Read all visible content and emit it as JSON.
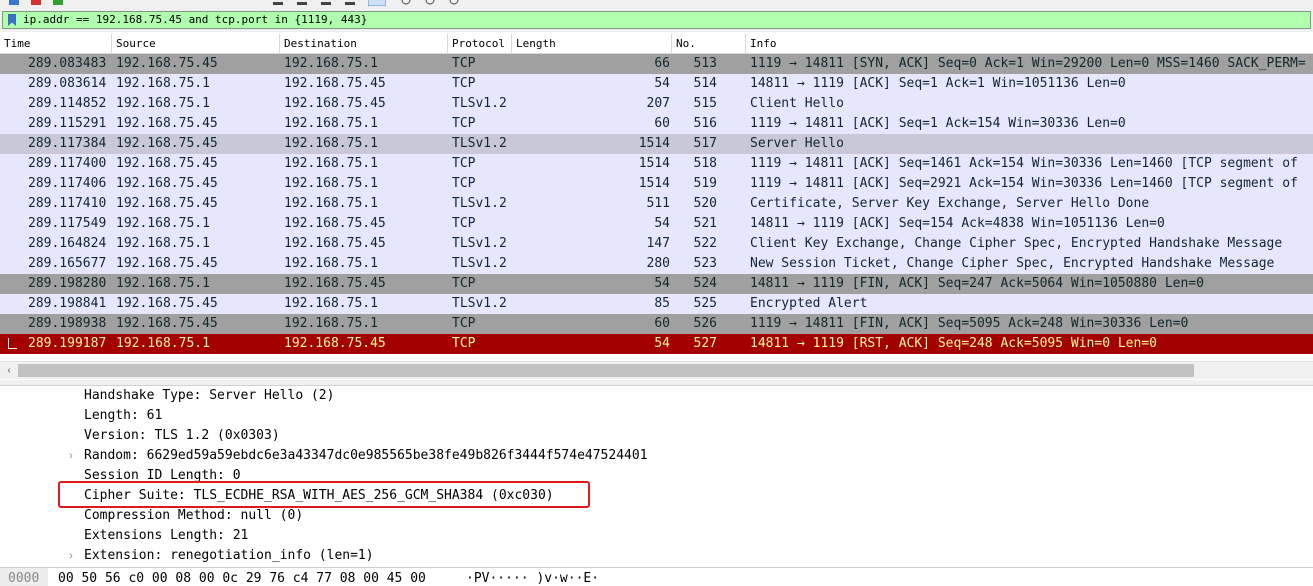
{
  "filter": {
    "value": "ip.addr == 192.168.75.45 and tcp.port in {1119, 443}"
  },
  "columns": {
    "time": "Time",
    "source": "Source",
    "destination": "Destination",
    "protocol": "Protocol",
    "length": "Length",
    "no": "No.",
    "info": "Info"
  },
  "packets": [
    {
      "time": "289.083483",
      "source": "192.168.75.45",
      "destination": "192.168.75.1",
      "protocol": "TCP",
      "length": "66",
      "no": "513",
      "info": "1119 → 14811 [SYN, ACK] Seq=0 Ack=1 Win=29200 Len=0 MSS=1460 SACK_PERM=",
      "style": "dark"
    },
    {
      "time": "289.083614",
      "source": "192.168.75.1",
      "destination": "192.168.75.45",
      "protocol": "TCP",
      "length": "54",
      "no": "514",
      "info": "14811 → 1119 [ACK] Seq=1 Ack=1 Win=1051136 Len=0",
      "style": "tcp"
    },
    {
      "time": "289.114852",
      "source": "192.168.75.1",
      "destination": "192.168.75.45",
      "protocol": "TLSv1.2",
      "length": "207",
      "no": "515",
      "info": "Client Hello",
      "style": "tls"
    },
    {
      "time": "289.115291",
      "source": "192.168.75.45",
      "destination": "192.168.75.1",
      "protocol": "TCP",
      "length": "60",
      "no": "516",
      "info": "1119 → 14811 [ACK] Seq=1 Ack=154 Win=30336 Len=0",
      "style": "tcp"
    },
    {
      "time": "289.117384",
      "source": "192.168.75.45",
      "destination": "192.168.75.1",
      "protocol": "TLSv1.2",
      "length": "1514",
      "no": "517",
      "info": "Server Hello",
      "style": "light2"
    },
    {
      "time": "289.117400",
      "source": "192.168.75.45",
      "destination": "192.168.75.1",
      "protocol": "TCP",
      "length": "1514",
      "no": "518",
      "info": "1119 → 14811 [ACK] Seq=1461 Ack=154 Win=30336 Len=1460 [TCP segment of",
      "style": "tcp"
    },
    {
      "time": "289.117406",
      "source": "192.168.75.45",
      "destination": "192.168.75.1",
      "protocol": "TCP",
      "length": "1514",
      "no": "519",
      "info": "1119 → 14811 [ACK] Seq=2921 Ack=154 Win=30336 Len=1460 [TCP segment of",
      "style": "tcp"
    },
    {
      "time": "289.117410",
      "source": "192.168.75.45",
      "destination": "192.168.75.1",
      "protocol": "TLSv1.2",
      "length": "511",
      "no": "520",
      "info": "Certificate, Server Key Exchange, Server Hello Done",
      "style": "tls"
    },
    {
      "time": "289.117549",
      "source": "192.168.75.1",
      "destination": "192.168.75.45",
      "protocol": "TCP",
      "length": "54",
      "no": "521",
      "info": "14811 → 1119 [ACK] Seq=154 Ack=4838 Win=1051136 Len=0",
      "style": "tcp"
    },
    {
      "time": "289.164824",
      "source": "192.168.75.1",
      "destination": "192.168.75.45",
      "protocol": "TLSv1.2",
      "length": "147",
      "no": "522",
      "info": "Client Key Exchange, Change Cipher Spec, Encrypted Handshake Message",
      "style": "tls"
    },
    {
      "time": "289.165677",
      "source": "192.168.75.45",
      "destination": "192.168.75.1",
      "protocol": "TLSv1.2",
      "length": "280",
      "no": "523",
      "info": "New Session Ticket, Change Cipher Spec, Encrypted Handshake Message",
      "style": "tls"
    },
    {
      "time": "289.198280",
      "source": "192.168.75.1",
      "destination": "192.168.75.45",
      "protocol": "TCP",
      "length": "54",
      "no": "524",
      "info": "14811 → 1119 [FIN, ACK] Seq=247 Ack=5064 Win=1050880 Len=0",
      "style": "dark"
    },
    {
      "time": "289.198841",
      "source": "192.168.75.45",
      "destination": "192.168.75.1",
      "protocol": "TLSv1.2",
      "length": "85",
      "no": "525",
      "info": "Encrypted Alert",
      "style": "tls"
    },
    {
      "time": "289.198938",
      "source": "192.168.75.45",
      "destination": "192.168.75.1",
      "protocol": "TCP",
      "length": "60",
      "no": "526",
      "info": "1119 → 14811 [FIN, ACK] Seq=5095 Ack=248 Win=30336 Len=0",
      "style": "dark"
    },
    {
      "time": "289.199187",
      "source": "192.168.75.1",
      "destination": "192.168.75.45",
      "protocol": "TCP",
      "length": "54",
      "no": "527",
      "info": "14811 → 1119 [RST, ACK] Seq=248 Ack=5095 Win=0 Len=0",
      "style": "rst"
    }
  ],
  "details": [
    {
      "text": "Handshake Type: Server Hello (2)",
      "expandable": false
    },
    {
      "text": "Length: 61",
      "expandable": false
    },
    {
      "text": "Version: TLS 1.2 (0x0303)",
      "expandable": false
    },
    {
      "text": "Random: 6629ed59a59ebdc6e3a43347dc0e985565be38fe49b826f3444f574e47524401",
      "expandable": true
    },
    {
      "text": "Session ID Length: 0",
      "expandable": false
    },
    {
      "text": "Cipher Suite: TLS_ECDHE_RSA_WITH_AES_256_GCM_SHA384 (0xc030)",
      "expandable": false
    },
    {
      "text": "Compression Method: null (0)",
      "expandable": false
    },
    {
      "text": "Extensions Length: 21",
      "expandable": false
    },
    {
      "text": "Extension: renegotiation_info (len=1)",
      "expandable": true
    }
  ],
  "bytes": {
    "offset": "0000",
    "hex": "00 50 56 c0 00 08 00 0c  29 76 c4 77 08 00 45 00",
    "ascii": "·PV····· )v·w··E·"
  },
  "colors": {
    "filter_ok": "#afffaf",
    "tcp_row": "#e7e6ff",
    "dark_row": "#a0a0a0",
    "selected_row": "#c8c8d8",
    "rst_row": "#a40000",
    "highlight": "#e0191b"
  }
}
